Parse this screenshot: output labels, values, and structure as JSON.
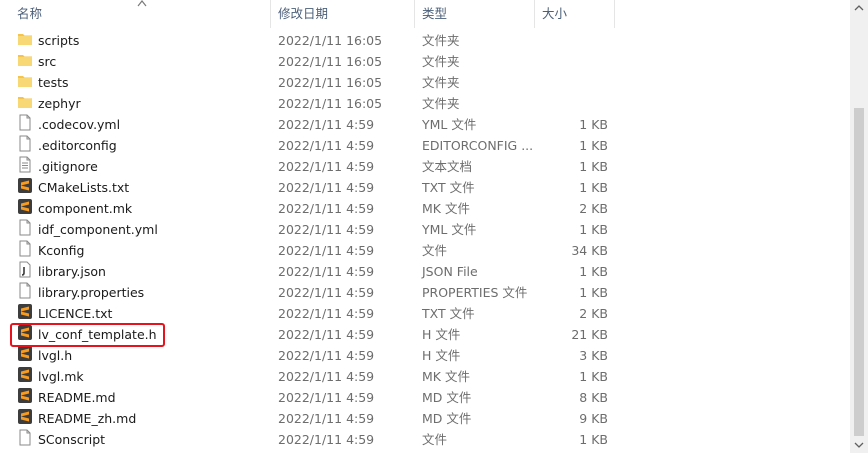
{
  "columns": {
    "name": "名称",
    "date": "修改日期",
    "type": "类型",
    "size": "大小"
  },
  "rows": [
    {
      "name": "scripts",
      "date": "2022/1/11 16:05",
      "type": "文件夹",
      "size": "",
      "icon": "folder"
    },
    {
      "name": "src",
      "date": "2022/1/11 16:05",
      "type": "文件夹",
      "size": "",
      "icon": "folder"
    },
    {
      "name": "tests",
      "date": "2022/1/11 16:05",
      "type": "文件夹",
      "size": "",
      "icon": "folder"
    },
    {
      "name": "zephyr",
      "date": "2022/1/11 16:05",
      "type": "文件夹",
      "size": "",
      "icon": "folder"
    },
    {
      "name": ".codecov.yml",
      "date": "2022/1/11 4:59",
      "type": "YML 文件",
      "size": "1 KB",
      "icon": "file"
    },
    {
      "name": ".editorconfig",
      "date": "2022/1/11 4:59",
      "type": "EDITORCONFIG ...",
      "size": "1 KB",
      "icon": "file"
    },
    {
      "name": ".gitignore",
      "date": "2022/1/11 4:59",
      "type": "文本文档",
      "size": "1 KB",
      "icon": "text"
    },
    {
      "name": "CMakeLists.txt",
      "date": "2022/1/11 4:59",
      "type": "TXT 文件",
      "size": "1 KB",
      "icon": "sublime"
    },
    {
      "name": "component.mk",
      "date": "2022/1/11 4:59",
      "type": "MK 文件",
      "size": "2 KB",
      "icon": "sublime"
    },
    {
      "name": "idf_component.yml",
      "date": "2022/1/11 4:59",
      "type": "YML 文件",
      "size": "1 KB",
      "icon": "file"
    },
    {
      "name": "Kconfig",
      "date": "2022/1/11 4:59",
      "type": "文件",
      "size": "34 KB",
      "icon": "file"
    },
    {
      "name": "library.json",
      "date": "2022/1/11 4:59",
      "type": "JSON File",
      "size": "1 KB",
      "icon": "json"
    },
    {
      "name": "library.properties",
      "date": "2022/1/11 4:59",
      "type": "PROPERTIES 文件",
      "size": "1 KB",
      "icon": "file"
    },
    {
      "name": "LICENCE.txt",
      "date": "2022/1/11 4:59",
      "type": "TXT 文件",
      "size": "2 KB",
      "icon": "sublime"
    },
    {
      "name": "lv_conf_template.h",
      "date": "2022/1/11 4:59",
      "type": "H 文件",
      "size": "21 KB",
      "icon": "sublime"
    },
    {
      "name": "lvgl.h",
      "date": "2022/1/11 4:59",
      "type": "H 文件",
      "size": "3 KB",
      "icon": "sublime"
    },
    {
      "name": "lvgl.mk",
      "date": "2022/1/11 4:59",
      "type": "MK 文件",
      "size": "1 KB",
      "icon": "sublime"
    },
    {
      "name": "README.md",
      "date": "2022/1/11 4:59",
      "type": "MD 文件",
      "size": "8 KB",
      "icon": "sublime"
    },
    {
      "name": "README_zh.md",
      "date": "2022/1/11 4:59",
      "type": "MD 文件",
      "size": "9 KB",
      "icon": "sublime"
    },
    {
      "name": "SConscript",
      "date": "2022/1/11 4:59",
      "type": "文件",
      "size": "1 KB",
      "icon": "file"
    }
  ],
  "highlight": {
    "row_name": "lv_conf_template.h",
    "color": "#e8121c"
  },
  "colors": {
    "folder": "#f4c44e",
    "sublime": "#3d3d3d",
    "sublime_accent": "#f99b1c",
    "header_text": "#4c607a"
  }
}
